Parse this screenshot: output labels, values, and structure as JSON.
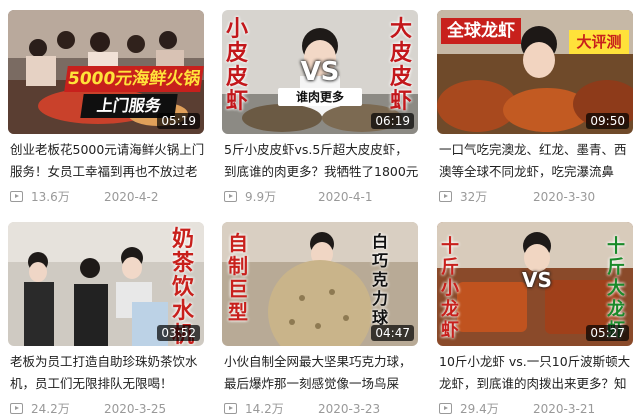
{
  "videos": [
    {
      "thumb_text": [
        "5000元海鲜火锅",
        "上门服务"
      ],
      "duration": "05:19",
      "title": "创业老板花5000元请海鲜火锅上门服务！女员工幸福到再也不放过老",
      "views": "13.6万",
      "date": "2020-4-2"
    },
    {
      "thumb_text": [
        "小皮皮虾",
        "VS",
        "大皮皮虾",
        "谁肉更多"
      ],
      "duration": "06:19",
      "title": "5斤小皮皮虾vs.5斤超大皮皮虾，到底谁的肉更多？我牺牲了1800元告",
      "views": "9.9万",
      "date": "2020-4-1"
    },
    {
      "thumb_text": [
        "全球龙虾",
        "大评测"
      ],
      "duration": "09:50",
      "title": "一口气吃完澳龙、红龙、墨青、西澳等全球不同龙虾，吃完瀑流鼻",
      "views": "32万",
      "date": "2020-3-30"
    },
    {
      "thumb_text": [
        "奶茶饮水机"
      ],
      "duration": "03:52",
      "title": "老板为员工打造自助珍珠奶茶饮水机，员工们无限排队无限喝！",
      "views": "24.2万",
      "date": "2020-3-25"
    },
    {
      "thumb_text": [
        "自制巨型",
        "白巧克力球"
      ],
      "duration": "04:47",
      "title": "小伙自制全网最大坚果巧克力球，最后爆炸那一刻感觉像一场鸟屎",
      "views": "14.2万",
      "date": "2020-3-23"
    },
    {
      "thumb_text": [
        "十斤小龙虾",
        "VS",
        "十斤大龙虾"
      ],
      "duration": "05:27",
      "title": "10斤小龙虾 vs.一只10斤波斯顿大龙虾，到底谁的肉拨出来更多？知",
      "views": "29.4万",
      "date": "2020-3-21"
    }
  ]
}
